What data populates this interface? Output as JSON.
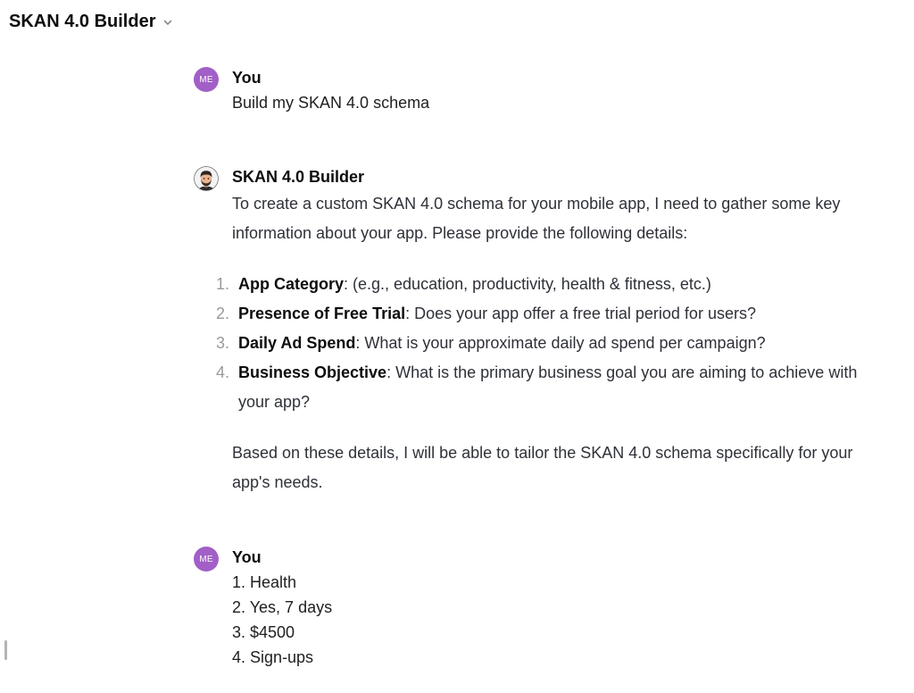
{
  "header": {
    "title": "SKAN 4.0 Builder",
    "chevron_icon": "chevron-down-icon"
  },
  "theme": {
    "user_avatar_color": "#a25fc7",
    "sidebar_handle_color": "#b4b4b4",
    "list_marker_color": "#9a9a9a"
  },
  "conversation": {
    "messages": [
      {
        "role": "user",
        "author": "You",
        "avatar_initials": "ME",
        "text": "Build my SKAN 4.0 schema"
      },
      {
        "role": "assistant",
        "author": "SKAN 4.0 Builder",
        "avatar_icon": "memoji-avatar",
        "intro": "To create a custom SKAN 4.0 schema for your mobile app, I need to gather some key information about your app. Please provide the following details:",
        "list": [
          {
            "marker": "1.",
            "label": "App Category",
            "text": ": (e.g., education, productivity, health & fitness, etc.)"
          },
          {
            "marker": "2.",
            "label": "Presence of Free Trial",
            "text": ": Does your app offer a free trial period for users?"
          },
          {
            "marker": "3.",
            "label": "Daily Ad Spend",
            "text": ": What is your approximate daily ad spend per campaign?"
          },
          {
            "marker": "4.",
            "label": "Business Objective",
            "text": ": What is the primary business goal you are aiming to achieve with your app?"
          }
        ],
        "outro": "Based on these details, I will be able to tailor the SKAN 4.0 schema specifically for your app's needs."
      },
      {
        "role": "user",
        "author": "You",
        "avatar_initials": "ME",
        "lines": [
          "1. Health",
          "2. Yes, 7 days",
          "3. $4500",
          "4. Sign-ups"
        ]
      }
    ]
  }
}
